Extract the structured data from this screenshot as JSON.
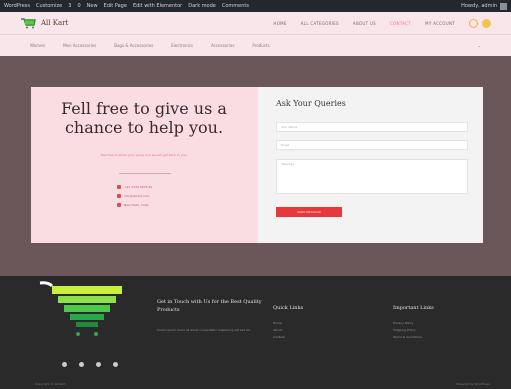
{
  "admin_bar": {
    "items": [
      "WordPress",
      "Customize",
      "3",
      "0",
      "New",
      "Edit Page",
      "Edit with Elementor",
      "Dark mode",
      "Comments"
    ],
    "user": "Howdy, admin"
  },
  "header": {
    "logo_text": "All Kart",
    "nav": [
      {
        "label": "HOME"
      },
      {
        "label": "ALL CATEGORIES"
      },
      {
        "label": "ABOUT US"
      },
      {
        "label": "CONTACT",
        "active": true
      },
      {
        "label": "MY ACCOUNT"
      }
    ],
    "accent_color": "#ff6fa0"
  },
  "category_bar": {
    "items": [
      "Women",
      "Men Accessories",
      "Bags & Accessories",
      "Electronics",
      "Accessories",
      "Products"
    ]
  },
  "contact": {
    "headline": "Fell free to give us a chance to help you.",
    "subline": "Feel free to share your query and we will get back to you.",
    "info": [
      {
        "icon": "phone-icon",
        "text": "+91 1234 5678 90"
      },
      {
        "icon": "mail-icon",
        "text": "info@allkart.com"
      },
      {
        "icon": "location-icon",
        "text": "New Delhi, India"
      }
    ]
  },
  "form": {
    "title": "Ask Your Queries",
    "name_placeholder": "Your Name",
    "email_placeholder": "Email",
    "message_placeholder": "Message",
    "submit_label": "SEND MESSAGE",
    "submit_color": "#e8383c"
  },
  "footer": {
    "tagline": "Get in Touch with Us for the Best Quality Products",
    "description": "Lorem ipsum dolor sit amet consectetur adipiscing elit sed do.",
    "quick_links_title": "Quick Links",
    "quick_links": [
      "Home",
      "About",
      "Contact"
    ],
    "important_links_title": "Important Links",
    "important_links": [
      "Privacy Policy",
      "Shipping Policy",
      "Terms & Conditions"
    ],
    "social": [
      "facebook-icon",
      "twitter-icon",
      "instagram-icon",
      "youtube-icon"
    ],
    "copyright": "Copyright © All Kart",
    "credits": "Powered by WordPress"
  }
}
